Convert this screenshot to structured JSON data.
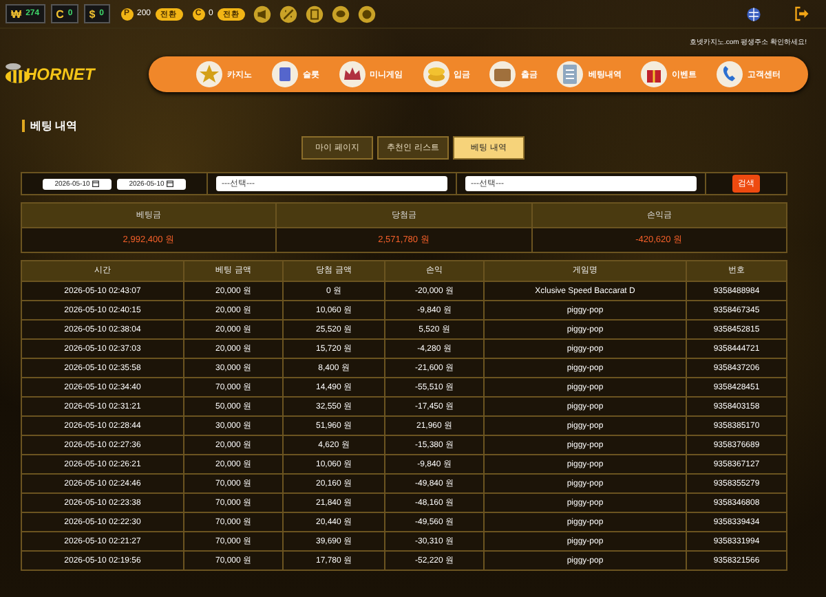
{
  "top_bar": {
    "wallets": [
      {
        "symbol": "₩",
        "amount": "274"
      },
      {
        "symbol": "C",
        "amount": "0"
      },
      {
        "symbol": "$",
        "amount": "0"
      }
    ],
    "points": [
      {
        "badge": "P",
        "amount": "200",
        "button": "전환"
      },
      {
        "badge": "C",
        "amount": "0",
        "button": "전환"
      }
    ]
  },
  "notice": "호넷카지노.com 평생주소 확인하세요!",
  "logo": "HORNET",
  "nav": [
    "카지노",
    "슬롯",
    "미니게임",
    "입금",
    "출금",
    "베팅내역",
    "이벤트",
    "고객센터"
  ],
  "page_title": "베팅 내역",
  "tabs": [
    {
      "label": "마이 페이지",
      "selected": false
    },
    {
      "label": "추천인 리스트",
      "selected": false
    },
    {
      "label": "베팅 내역",
      "selected": true
    }
  ],
  "filter": {
    "date_from": "2026-05-10",
    "date_to": "2026-05-10",
    "select_1": "---선택---",
    "select_2": "---선택---",
    "search_button": "검색"
  },
  "summary": [
    {
      "label": "베팅금",
      "value": "2,992,400 원"
    },
    {
      "label": "당첨금",
      "value": "2,571,780 원"
    },
    {
      "label": "손익금",
      "value": "-420,620 원"
    }
  ],
  "table": {
    "columns": [
      "시간",
      "베팅 금액",
      "당첨 금액",
      "손익",
      "게임명",
      "번호"
    ],
    "rows": [
      [
        "2026-05-10 02:43:07",
        "20,000 원",
        "0 원",
        "-20,000 원",
        "Xclusive Speed Baccarat D",
        "9358488984"
      ],
      [
        "2026-05-10 02:40:15",
        "20,000 원",
        "10,060 원",
        "-9,840 원",
        "piggy-pop",
        "9358467345"
      ],
      [
        "2026-05-10 02:38:04",
        "20,000 원",
        "25,520 원",
        "5,520 원",
        "piggy-pop",
        "9358452815"
      ],
      [
        "2026-05-10 02:37:03",
        "20,000 원",
        "15,720 원",
        "-4,280 원",
        "piggy-pop",
        "9358444721"
      ],
      [
        "2026-05-10 02:35:58",
        "30,000 원",
        "8,400 원",
        "-21,600 원",
        "piggy-pop",
        "9358437206"
      ],
      [
        "2026-05-10 02:34:40",
        "70,000 원",
        "14,490 원",
        "-55,510 원",
        "piggy-pop",
        "9358428451"
      ],
      [
        "2026-05-10 02:31:21",
        "50,000 원",
        "32,550 원",
        "-17,450 원",
        "piggy-pop",
        "9358403158"
      ],
      [
        "2026-05-10 02:28:44",
        "30,000 원",
        "51,960 원",
        "21,960 원",
        "piggy-pop",
        "9358385170"
      ],
      [
        "2026-05-10 02:27:36",
        "20,000 원",
        "4,620 원",
        "-15,380 원",
        "piggy-pop",
        "9358376689"
      ],
      [
        "2026-05-10 02:26:21",
        "20,000 원",
        "10,060 원",
        "-9,840 원",
        "piggy-pop",
        "9358367127"
      ],
      [
        "2026-05-10 02:24:46",
        "70,000 원",
        "20,160 원",
        "-49,840 원",
        "piggy-pop",
        "9358355279"
      ],
      [
        "2026-05-10 02:23:38",
        "70,000 원",
        "21,840 원",
        "-48,160 원",
        "piggy-pop",
        "9358346808"
      ],
      [
        "2026-05-10 02:22:30",
        "70,000 원",
        "20,440 원",
        "-49,560 원",
        "piggy-pop",
        "9358339434"
      ],
      [
        "2026-05-10 02:21:27",
        "70,000 원",
        "39,690 원",
        "-30,310 원",
        "piggy-pop",
        "9358331994"
      ],
      [
        "2026-05-10 02:19:56",
        "70,000 원",
        "17,780 원",
        "-52,220 원",
        "piggy-pop",
        "9358321566"
      ]
    ]
  }
}
